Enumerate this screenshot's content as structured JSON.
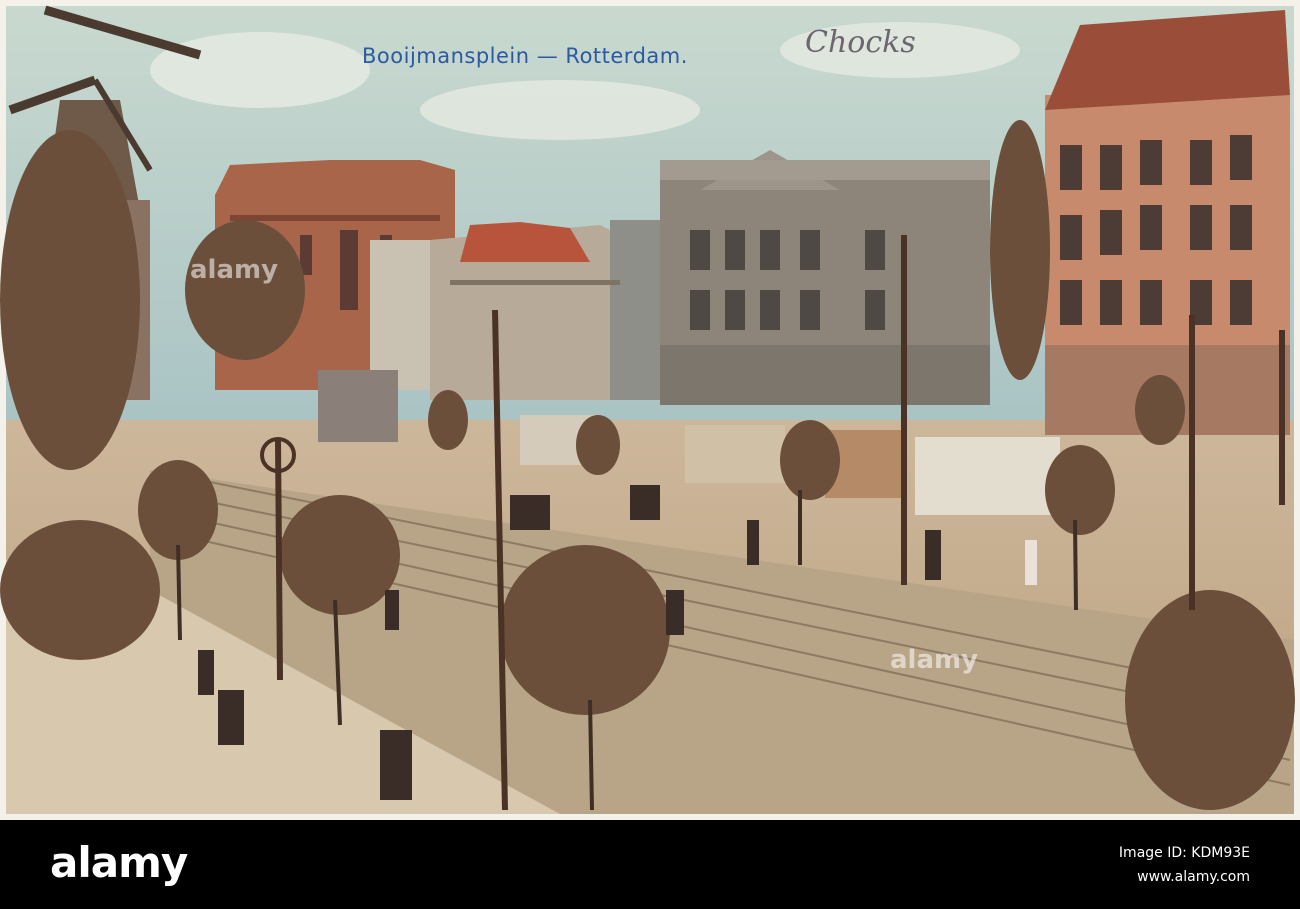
{
  "postcard": {
    "caption": "Booijmansplein — Rotterdam.",
    "handwriting": "Chocks"
  },
  "watermark": {
    "text": "alamy",
    "footer_logo": "alamy",
    "image_id": "Image ID: KDM93E",
    "site": "www.alamy.com"
  },
  "colors": {
    "sky": "#b9cfc9",
    "brick": "#b06a4a",
    "pavement": "#c9b293",
    "tree": "#6a4e3a",
    "caption": "#2a5aa0"
  }
}
